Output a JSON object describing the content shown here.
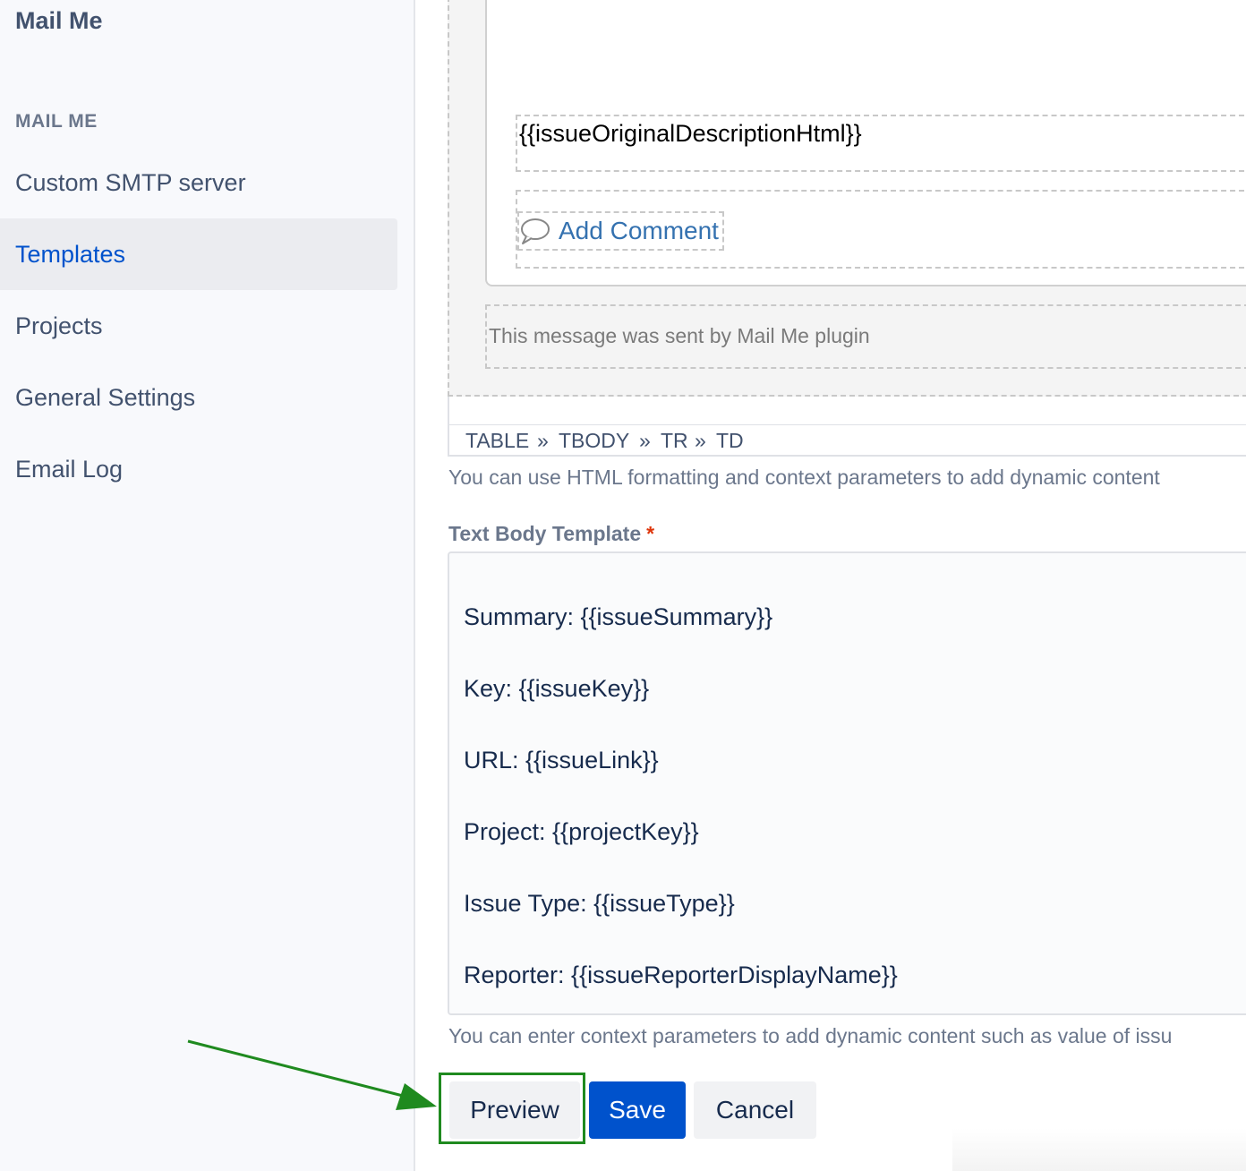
{
  "sidebar": {
    "app_title": "Mail Me",
    "section_heading": "MAIL ME",
    "items": [
      {
        "label": "Custom SMTP server",
        "active": false
      },
      {
        "label": "Templates",
        "active": true
      },
      {
        "label": "Projects",
        "active": false
      },
      {
        "label": "General Settings",
        "active": false
      },
      {
        "label": "Email Log",
        "active": false
      }
    ]
  },
  "editor": {
    "description_placeholder": "{{issueOriginalDescriptionHtml}}",
    "add_comment_label": "Add Comment",
    "footer_text": "This message was sent by Mail Me plugin",
    "path": [
      "TABLE",
      "»",
      "TBODY",
      "»",
      "TR",
      "»",
      "TD"
    ],
    "help_text": "You can use HTML formatting and context parameters to add dynamic content"
  },
  "text_body": {
    "label": "Text Body Template",
    "required_mark": "*",
    "lines": [
      "Summary: {{issueSummary}}",
      "Key: {{issueKey}}",
      "URL: {{issueLink}}",
      "Project: {{projectKey}}",
      "Issue Type: {{issueType}}",
      "Reporter: {{issueReporterDisplayName}}"
    ],
    "help_text": "You can enter context parameters to add dynamic content such as value of issu"
  },
  "actions": {
    "preview_label": "Preview",
    "save_label": "Save",
    "cancel_label": "Cancel"
  },
  "colors": {
    "primary": "#0052cc",
    "highlight": "#1f8a1f",
    "link": "#3572b0"
  },
  "icons": {
    "comment": "speech-bubble-icon",
    "annotation": "arrow-annotation"
  }
}
